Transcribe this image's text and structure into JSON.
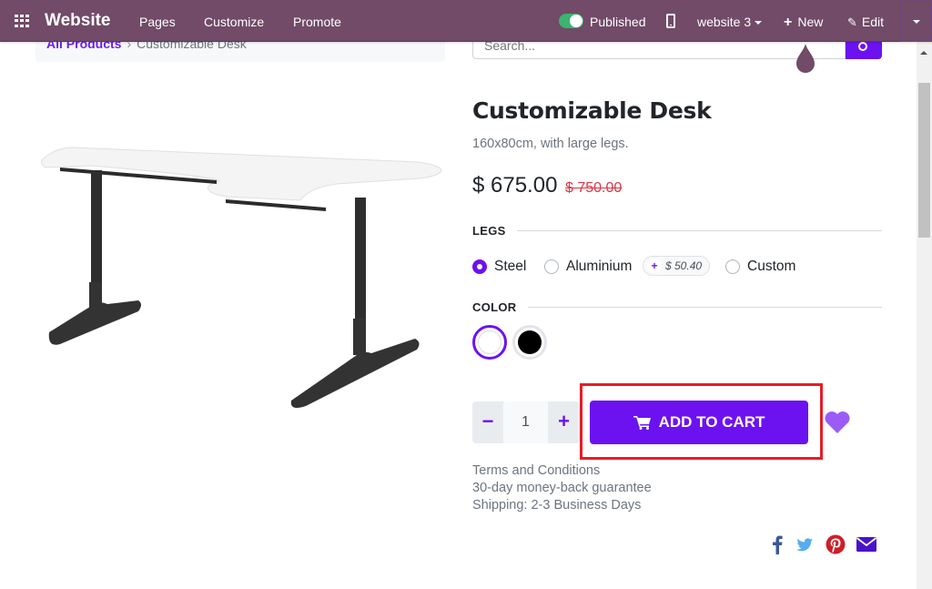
{
  "navbar": {
    "brand": "Website",
    "links": [
      "Pages",
      "Customize",
      "Promote"
    ],
    "published_label": "Published",
    "published_on": true,
    "website_select": "website 3",
    "new_label": "New",
    "edit_label": "Edit"
  },
  "breadcrumb": {
    "parent": "All Products",
    "separator": "›",
    "current": "Customizable Desk"
  },
  "search": {
    "placeholder": "Search..."
  },
  "product": {
    "title": "Customizable Desk",
    "subtitle": "160x80cm, with large legs.",
    "price": "$ 675.00",
    "old_price": "$ 750.00",
    "image_alt": "Customizable Desk product image"
  },
  "attributes": {
    "legs": {
      "label": "LEGS",
      "options": [
        {
          "label": "Steel",
          "checked": true
        },
        {
          "label": "Aluminium",
          "checked": false,
          "extra_price": "$ 50.40"
        },
        {
          "label": "Custom",
          "checked": false
        }
      ],
      "extra_plus": "+"
    },
    "color": {
      "label": "COLOR",
      "swatches": [
        {
          "name": "White",
          "hex": "#ffffff",
          "selected": true
        },
        {
          "name": "Black",
          "hex": "#000000",
          "selected": false
        }
      ]
    }
  },
  "cart": {
    "quantity": "1",
    "minus": "−",
    "plus": "+",
    "add_to_cart_label": "ADD TO CART"
  },
  "info": [
    "Terms and Conditions",
    "30-day money-back guarantee",
    "Shipping: 2-3 Business Days"
  ],
  "colors": {
    "navbar": "#714B67",
    "primary": "#6c12f0",
    "highlight": "#e81d25",
    "old_price": "#dc3545",
    "published_toggle": "#3cb371"
  },
  "social": [
    "facebook-icon",
    "twitter-icon",
    "pinterest-icon",
    "email-icon"
  ]
}
